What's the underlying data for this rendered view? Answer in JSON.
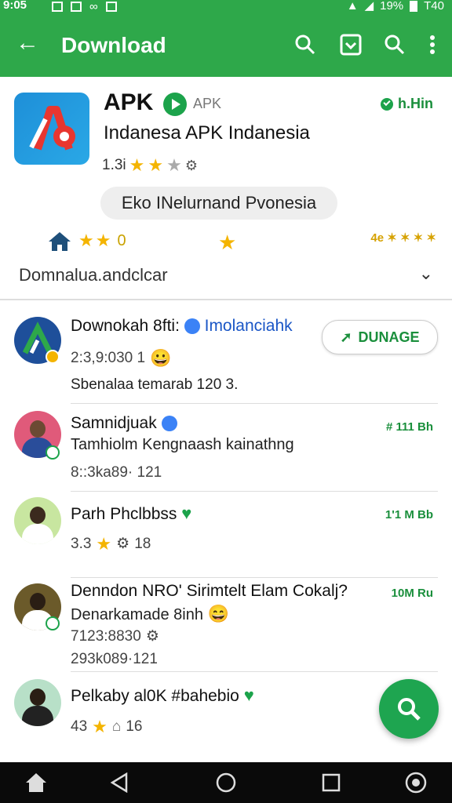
{
  "status_bar": {
    "time": "9:05",
    "battery": "19%",
    "clock_right": "T40"
  },
  "app_bar": {
    "title": "Download",
    "icons": [
      "back-arrow-icon",
      "search-icon",
      "download-box-icon",
      "search-icon",
      "more-vert-icon"
    ]
  },
  "app": {
    "name": "APK",
    "tag": "APK",
    "size": "h.Hin",
    "subtitle": "Indanesa APK Indanesia",
    "rating": "1.3i",
    "chip": "Eko  INelurnand Pvonesia",
    "stat_count": "0",
    "stat_right": "4e ✶ ✶ ✶ ✶",
    "description": "Domnalua.andclcar"
  },
  "list": [
    {
      "title": "Downokah 8fti:",
      "title_link": "Imolanciahk",
      "meta": "2:3,9:030  1",
      "sub": "Sbenalaa temarab 120 3.",
      "button": "DUNAGE"
    },
    {
      "title": "Samnidjuak",
      "sub": "Tamhiolm Kengnaash kainathng",
      "meta": "8::3ka89· 121",
      "size": "# 111 Bh"
    },
    {
      "title": "Parh Phclbbss",
      "meta_rating": "3.3",
      "meta_count": "18",
      "size": "1'1 M Bb"
    },
    {
      "title": "Denndon NRO' Sirimtelt Elam Cokalj?",
      "sub": "Denarkamade 8inh",
      "meta": "7123:8830",
      "meta2": "293k089·121",
      "size": "10M Ru"
    },
    {
      "title": "Pelkaby al0K #bahebio",
      "meta_rating": "43",
      "meta_count": "16"
    }
  ],
  "colors": {
    "primary": "#2ea84a",
    "accent_text": "#1a8f3c",
    "star": "#f4b400"
  }
}
